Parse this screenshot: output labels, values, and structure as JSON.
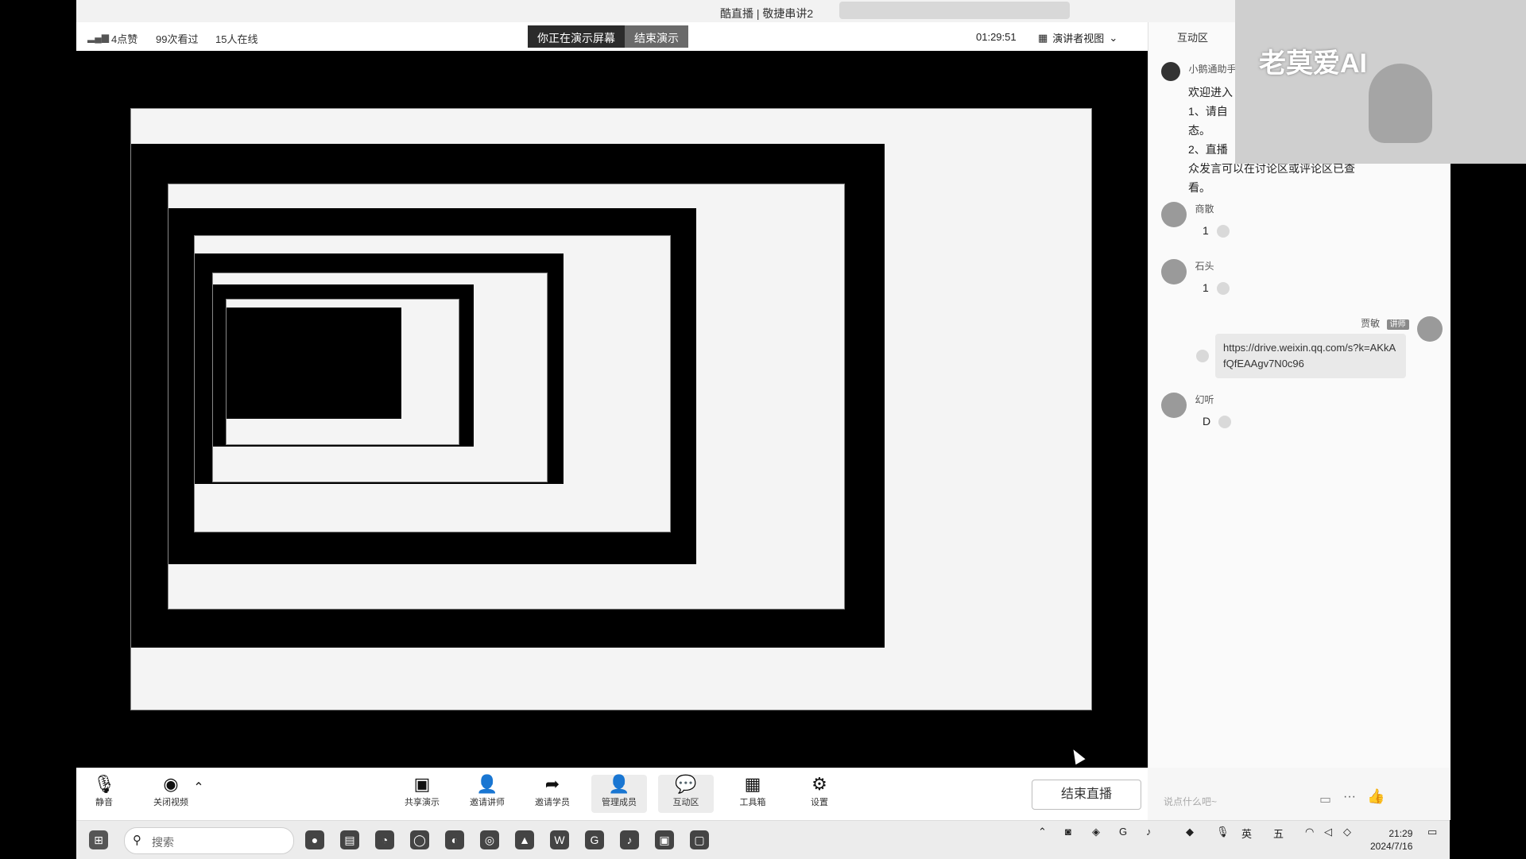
{
  "window_title": "酷直播 | 敬捷串讲2",
  "stats": {
    "signal": "▂▄▆",
    "likes": "4点赞",
    "views": "99次看过",
    "online": "15人在线"
  },
  "presenting": {
    "label": "你正在演示屏幕",
    "end": "结束演示"
  },
  "timer": "01:29:51",
  "view_mode": "演讲者视图",
  "panel": {
    "title": "互动区",
    "assistant_name": "小鹅通助手",
    "welcome_lines": [
      "欢迎进入",
      "1、请自",
      "态。",
      "2、直播",
      "众发言可以在讨论区或评论区已查",
      "看。"
    ],
    "messages": [
      {
        "name": "商散",
        "text": "1"
      },
      {
        "name": "石头",
        "text": "1"
      },
      {
        "name": "贾敏",
        "tag": "讲师",
        "text": "https://drive.weixin.qq.com/s?k=AKkAfQfEAAgv7N0c96"
      },
      {
        "name": "幻听",
        "text": "D"
      }
    ],
    "input_placeholder": "说点什么吧~"
  },
  "webcam": {
    "watermark": "老莫爱AI"
  },
  "toolbar": {
    "mic": "静音",
    "camera": "关闭视频",
    "share": "共享演示",
    "invite_lecturer": "邀请讲师",
    "invite_student": "邀请学员",
    "members": "管理成员",
    "interact": "互动区",
    "tools": "工具箱",
    "settings": "设置",
    "end_live": "结束直播"
  },
  "taskbar": {
    "search": "搜索",
    "ime": "英",
    "ime2": "五",
    "time": "21:29",
    "date": "2024/7/16"
  }
}
